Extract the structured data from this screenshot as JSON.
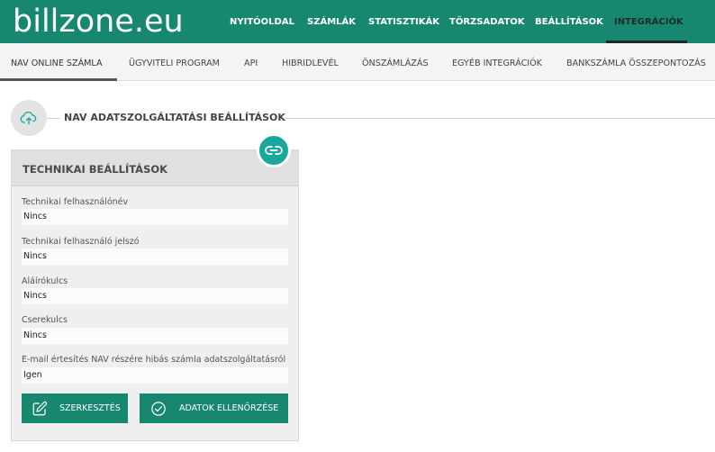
{
  "brand": {
    "logo_text": "billzone.eu",
    "primary_color": "#17876f",
    "accent_color": "#1aa79d"
  },
  "topnav": {
    "items": [
      {
        "label": "NYITÓOLDAL"
      },
      {
        "label": "SZÁMLÁK"
      },
      {
        "label": "STATISZTIKÁK"
      },
      {
        "label": "TÖRZSADATOK"
      },
      {
        "label": "BEÁLLÍTÁSOK"
      },
      {
        "label": "INTEGRÁCIÓK",
        "active": true
      }
    ]
  },
  "subnav": {
    "items": [
      {
        "label": "NAV ONLINE SZÁMLA",
        "active": true
      },
      {
        "label": "ÜGYVITELI PROGRAM"
      },
      {
        "label": "API"
      },
      {
        "label": "HIBRIDLEVÉL"
      },
      {
        "label": "ÖNSZÁMLÁZÁS"
      },
      {
        "label": "EGYÉB INTEGRÁCIÓK"
      },
      {
        "label": "BANKSZÁMLA ÖSSZEPONTOZÁS"
      }
    ]
  },
  "section": {
    "icon": "cloud-upload-icon",
    "title": "NAV ADATSZOLGÁLTATÁSI BEÁLLÍTÁSOK"
  },
  "card": {
    "title": "TECHNIKAI BEÁLLÍTÁSOK",
    "badge_icon": "link-icon",
    "fields": [
      {
        "label": "Technikai felhasználónév",
        "value": "Nincs"
      },
      {
        "label": "Technikai felhasználó jelszó",
        "value": "Nincs"
      },
      {
        "label": "Aláírókulcs",
        "value": "Nincs"
      },
      {
        "label": "Cserekulcs",
        "value": "Nincs"
      },
      {
        "label": "E-mail értesítés NAV részére hibás számla adatszolgáltatásról",
        "value": "Igen"
      }
    ],
    "buttons": {
      "edit_label": "SZERKESZTÉS",
      "edit_icon": "edit-icon",
      "verify_label": "ADATOK ELLENŐRZÉSE",
      "verify_icon": "check-circle-icon"
    }
  }
}
